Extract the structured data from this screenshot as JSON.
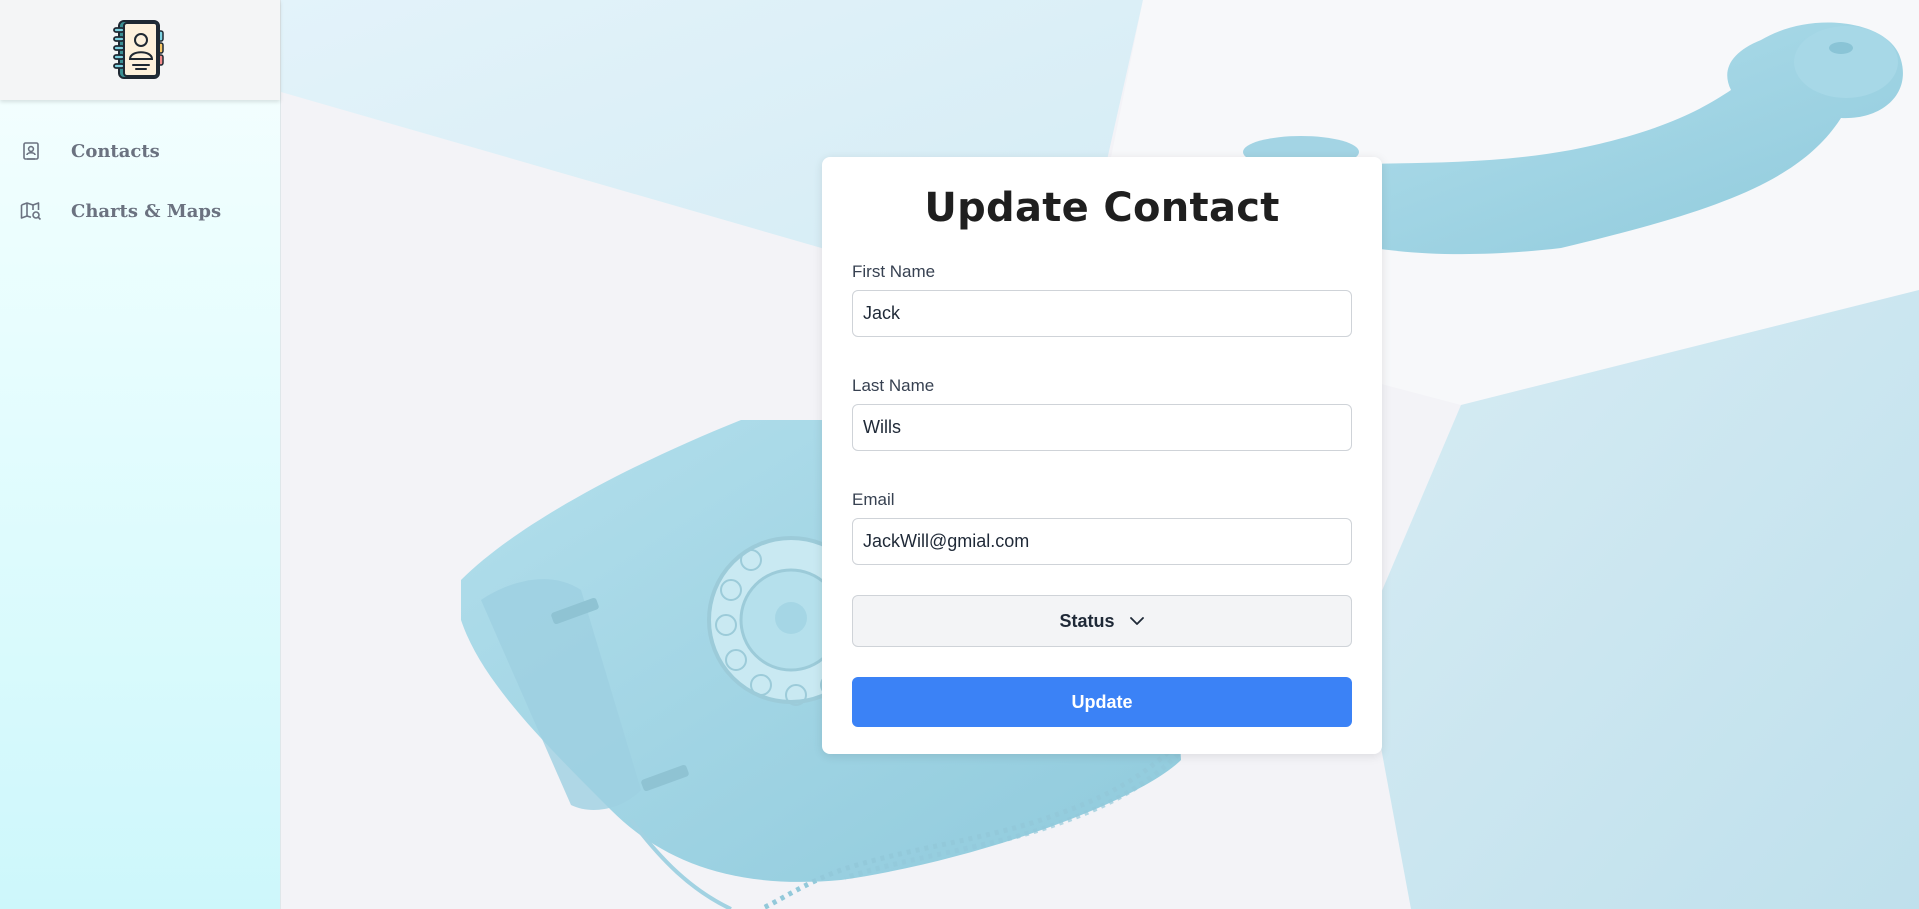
{
  "sidebar": {
    "logo_icon": "contact-book-icon",
    "items": [
      {
        "label": "Contacts",
        "icon": "contact-card-icon"
      },
      {
        "label": "Charts & Maps",
        "icon": "map-search-icon"
      }
    ]
  },
  "form": {
    "title": "Update Contact",
    "fields": {
      "first_name": {
        "label": "First Name",
        "value": "Jack"
      },
      "last_name": {
        "label": "Last Name",
        "value": "Wills"
      },
      "email": {
        "label": "Email",
        "value": "JackWill@gmial.com"
      }
    },
    "status_label": "Status",
    "submit_label": "Update"
  },
  "colors": {
    "accent": "#3b82f6",
    "sidebar_bg": "#e6fdfe",
    "phone": "#a8d8e6"
  }
}
